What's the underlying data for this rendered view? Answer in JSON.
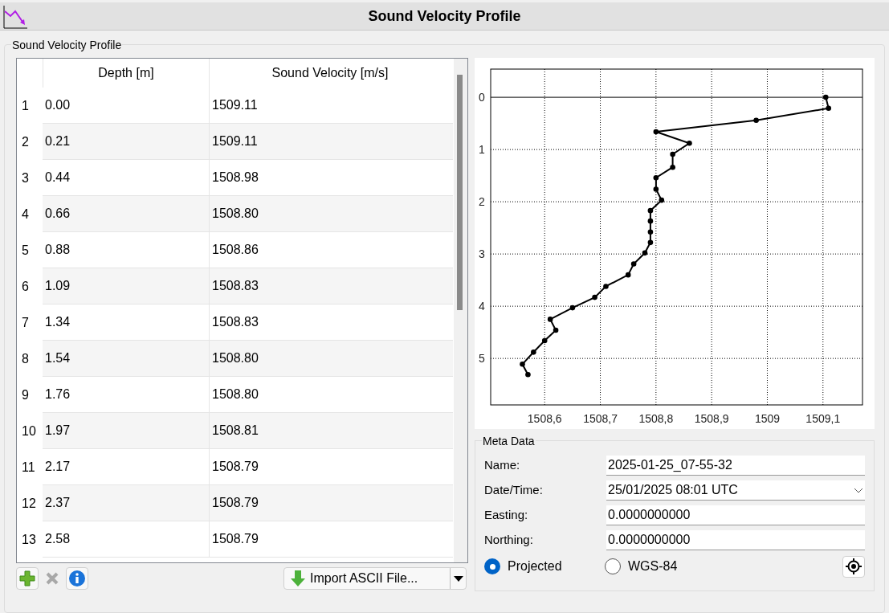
{
  "window": {
    "title": "Sound Velocity Profile"
  },
  "group_title": "Sound Velocity Profile",
  "table": {
    "columns": [
      "Depth [m]",
      "Sound Velocity [m/s]"
    ],
    "rows": [
      {
        "index": "1",
        "depth": "0.00",
        "velocity": "1509.11"
      },
      {
        "index": "2",
        "depth": "0.21",
        "velocity": "1509.11"
      },
      {
        "index": "3",
        "depth": "0.44",
        "velocity": "1508.98"
      },
      {
        "index": "4",
        "depth": "0.66",
        "velocity": "1508.80"
      },
      {
        "index": "5",
        "depth": "0.88",
        "velocity": "1508.86"
      },
      {
        "index": "6",
        "depth": "1.09",
        "velocity": "1508.83"
      },
      {
        "index": "7",
        "depth": "1.34",
        "velocity": "1508.83"
      },
      {
        "index": "8",
        "depth": "1.54",
        "velocity": "1508.80"
      },
      {
        "index": "9",
        "depth": "1.76",
        "velocity": "1508.80"
      },
      {
        "index": "10",
        "depth": "1.97",
        "velocity": "1508.81"
      },
      {
        "index": "11",
        "depth": "2.17",
        "velocity": "1508.79"
      },
      {
        "index": "12",
        "depth": "2.37",
        "velocity": "1508.79"
      },
      {
        "index": "13",
        "depth": "2.58",
        "velocity": "1508.79"
      }
    ]
  },
  "import_button": "Import ASCII File...",
  "chart": {
    "chart_data": {
      "type": "line",
      "x": [
        1509.105,
        1509.11,
        1508.98,
        1508.8,
        1508.86,
        1508.83,
        1508.83,
        1508.8,
        1508.8,
        1508.81,
        1508.79,
        1508.79,
        1508.79,
        1508.79,
        1508.78,
        1508.76,
        1508.75,
        1508.71,
        1508.69,
        1508.65,
        1508.61,
        1508.62,
        1508.6,
        1508.58,
        1508.56,
        1508.57
      ],
      "grid": true,
      "series": [
        {
          "color": "#000000",
          "marker": "circle",
          "values": [
            0,
            0.21,
            0.44,
            0.66,
            0.88,
            1.09,
            1.34,
            1.54,
            1.76,
            1.97,
            2.17,
            2.37,
            2.58,
            2.78,
            2.98,
            3.19,
            3.4,
            3.62,
            3.83,
            4.03,
            4.25,
            4.46,
            4.66,
            4.88,
            5.11,
            5.31
          ]
        }
      ],
      "xlim": [
        1508.503,
        1509.171
      ],
      "ylim": [
        5.89,
        -0.54
      ],
      "xticks": [
        {
          "value": 1508.6,
          "label": "1508,6"
        },
        {
          "value": 1508.7,
          "label": "1508,7"
        },
        {
          "value": 1508.8,
          "label": "1508,8"
        },
        {
          "value": 1508.9,
          "label": "1508,9"
        },
        {
          "value": 1509,
          "label": "1509"
        },
        {
          "value": 1509.1,
          "label": "1509,1"
        }
      ],
      "yticks": [
        0,
        1,
        2,
        3,
        4,
        5
      ]
    }
  },
  "meta": {
    "title": "Meta Data",
    "fields": [
      {
        "label": "Name:",
        "value": "2025-01-25_07-55-32",
        "kind": "text"
      },
      {
        "label": "Date/Time:",
        "value": "25/01/2025 08:01 UTC",
        "kind": "dropdown"
      },
      {
        "label": "Easting:",
        "value": "0.0000000000",
        "kind": "text"
      },
      {
        "label": "Northing:",
        "value": "0.0000000000",
        "kind": "text"
      }
    ],
    "radios": [
      {
        "label": "Projected",
        "selected": true
      },
      {
        "label": "WGS-84",
        "selected": false
      }
    ]
  }
}
